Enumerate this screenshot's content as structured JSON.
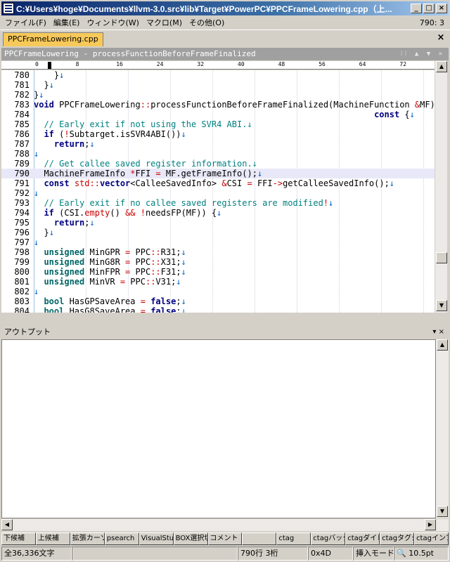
{
  "window": {
    "title": "C:¥Users¥hoge¥Documents¥llvm-3.0.src¥lib¥Target¥PowerPC¥PPCFrameLowering.cpp（上..."
  },
  "menu": {
    "items": [
      "ファイル(F)",
      "編集(E)",
      "ウィンドウ(W)",
      "マクロ(M)",
      "その他(O)"
    ],
    "cursor": "790: 3"
  },
  "tab": {
    "label": "PPCFrameLowering.cpp",
    "close": "×"
  },
  "pane": {
    "header": "PPCFrameLowering - processFunctionBeforeFrameFinalized",
    "controls": "⁝⁝ ▲ ▼ ×"
  },
  "ruler": {
    "marks": [
      "0",
      "8",
      "16",
      "24",
      "32",
      "40",
      "48",
      "56",
      "64",
      "72",
      "8"
    ]
  },
  "code": {
    "current_line": "790",
    "lines": [
      {
        "n": "780",
        "html": "    }<span class=\"nl\">↓</span>"
      },
      {
        "n": "781",
        "html": "  }<span class=\"nl\">↓</span>"
      },
      {
        "n": "782",
        "html": "}<span class=\"nl\">↓</span>"
      },
      {
        "n": "783",
        "html": "<span class=\"kw\">void</span> PPCFrameLowering<span class=\"op\">::</span>processFunctionBeforeFrameFinalized(MachineFunction <span class=\"op\">&amp;</span>MF)<span class=\"nl\">↓</span>"
      },
      {
        "n": "784",
        "html": "                                                                   <span class=\"kw\">const</span> {<span class=\"nl\">↓</span>"
      },
      {
        "n": "785",
        "html": "  <span class=\"cm\">// Early exit if not using the SVR4 ABI.↓</span>"
      },
      {
        "n": "786",
        "html": "  <span class=\"kw\">if</span> (<span class=\"op\">!</span>Subtarget.isSVR4ABI())<span class=\"nl\">↓</span>"
      },
      {
        "n": "787",
        "html": "    <span class=\"kw\">return</span>;<span class=\"nl\">↓</span>"
      },
      {
        "n": "788",
        "html": "<span class=\"nl\">↓</span>"
      },
      {
        "n": "789",
        "html": "  <span class=\"cm\">// Get callee saved register information.↓</span>"
      },
      {
        "n": "790",
        "html": "  MachineFrameInfo <span class=\"op\">*</span>FFI <span class=\"op\">=</span> MF.getFrameInfo();<span class=\"nl\">↓</span>"
      },
      {
        "n": "791",
        "html": "  <span class=\"kw\">const</span> <span class=\"op\">std::</span><span class=\"kw\">vector</span>&lt;CalleeSavedInfo&gt; <span class=\"op\">&amp;</span>CSI <span class=\"op\">=</span> FFI<span class=\"op\">-&gt;</span>getCalleeSavedInfo();<span class=\"nl\">↓</span>"
      },
      {
        "n": "792",
        "html": "<span class=\"nl\">↓</span>"
      },
      {
        "n": "793",
        "html": "  <span class=\"cm\">// Early exit if no callee saved registers are modified</span><span class=\"op\">!</span><span class=\"nl\">↓</span>"
      },
      {
        "n": "794",
        "html": "  <span class=\"kw\">if</span> (CSI.<span class=\"op\">empty</span>() <span class=\"op\">&amp;&amp;</span> <span class=\"op\">!</span>needsFP(MF)) {<span class=\"nl\">↓</span>"
      },
      {
        "n": "795",
        "html": "    <span class=\"kw\">return</span>;<span class=\"nl\">↓</span>"
      },
      {
        "n": "796",
        "html": "  }<span class=\"nl\">↓</span>"
      },
      {
        "n": "797",
        "html": "<span class=\"nl\">↓</span>"
      },
      {
        "n": "798",
        "html": "  <span class=\"ty\">unsigned</span> MinGPR <span class=\"op\">=</span> PPC<span class=\"op\">::</span>R31;<span class=\"nl\">↓</span>"
      },
      {
        "n": "799",
        "html": "  <span class=\"ty\">unsigned</span> MinG8R <span class=\"op\">=</span> PPC<span class=\"op\">::</span>X31;<span class=\"nl\">↓</span>"
      },
      {
        "n": "800",
        "html": "  <span class=\"ty\">unsigned</span> MinFPR <span class=\"op\">=</span> PPC<span class=\"op\">::</span>F31;<span class=\"nl\">↓</span>"
      },
      {
        "n": "801",
        "html": "  <span class=\"ty\">unsigned</span> MinVR <span class=\"op\">=</span> PPC<span class=\"op\">::</span>V31;<span class=\"nl\">↓</span>"
      },
      {
        "n": "802",
        "html": "<span class=\"nl\">↓</span>"
      },
      {
        "n": "803",
        "html": "  <span class=\"ty\">bool</span> HasGPSaveArea <span class=\"op\">=</span> <span class=\"kw\">false</span>;<span class=\"nl\">↓</span>"
      },
      {
        "n": "804",
        "html": "  <span class=\"ty\">bool</span> HasG8SaveArea <span class=\"op\">=</span> <span class=\"kw\">false</span>;<span class=\"nl\">↓</span>"
      }
    ]
  },
  "output": {
    "title": "アウトプット",
    "controls": "▾ ×"
  },
  "fkeys": [
    "下候補",
    "上候補",
    "拡張カーソル",
    "psearch",
    "VisualStu",
    "BOX選択切",
    "コメント",
    "",
    "ctag",
    "",
    "ctagバック",
    "ctagダイレク",
    "ctagタグジ",
    "ctagインフ"
  ],
  "status": {
    "chars": "全36,336文字",
    "pos": "790行 3桁",
    "code": "0x4D",
    "mode": "挿入モード",
    "zoom": "10.5pt"
  }
}
